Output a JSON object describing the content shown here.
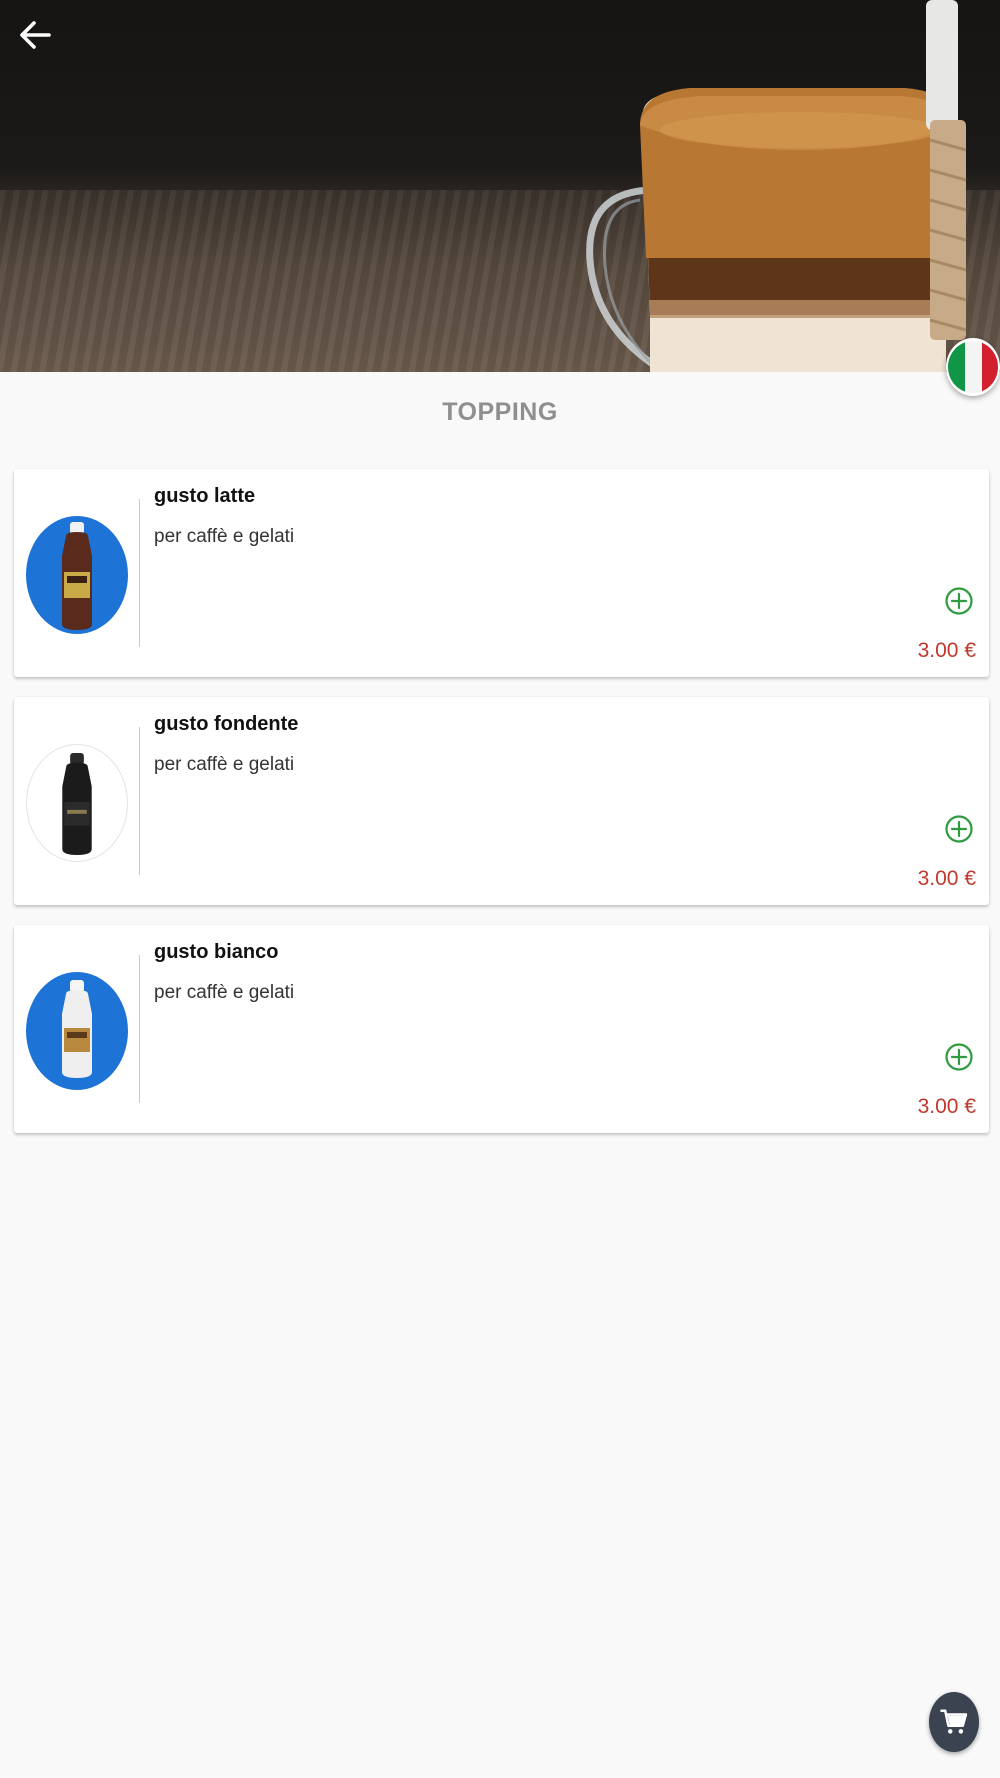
{
  "header": {
    "back_icon": "arrow-left-icon",
    "language_flag": "italy-flag-icon",
    "colors": {
      "back_icon": "#ffffff"
    }
  },
  "section": {
    "title": "TOPPING"
  },
  "products": [
    {
      "name": "gusto latte",
      "description": "per caffè e gelati",
      "price": "3.00 €",
      "thumb_bg": "#1e74d6",
      "bottle_color": "#5a2a1c"
    },
    {
      "name": "gusto fondente",
      "description": "per caffè e gelati",
      "price": "3.00 €",
      "thumb_bg": "#ffffff",
      "bottle_color": "#1b1b1b"
    },
    {
      "name": "gusto bianco",
      "description": "per caffè e gelati",
      "price": "3.00 €",
      "thumb_bg": "#1e74d6",
      "bottle_color": "#efefef"
    }
  ],
  "icons": {
    "add": "plus-circle-icon",
    "cart": "shopping-cart-icon"
  },
  "colors": {
    "price": "#c0392b",
    "add": "#2e9b3f",
    "title": "#8f8f8f",
    "cart_fab": "#3b4350"
  }
}
